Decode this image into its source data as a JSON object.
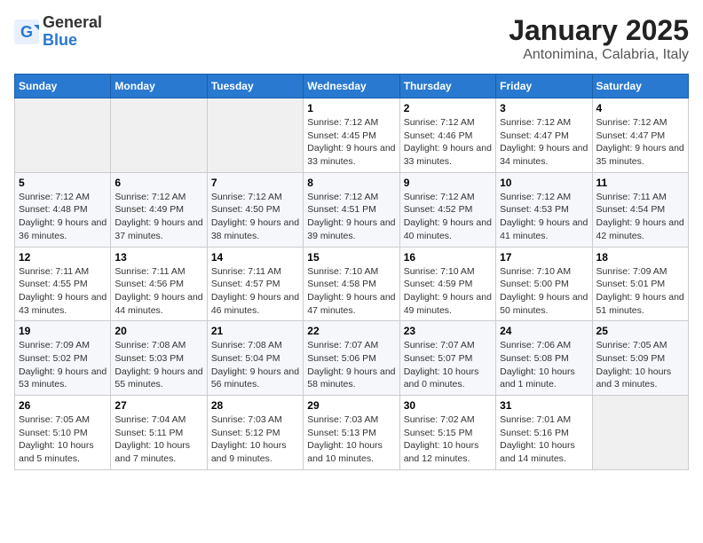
{
  "header": {
    "logo_general": "General",
    "logo_blue": "Blue",
    "month": "January 2025",
    "location": "Antonimina, Calabria, Italy"
  },
  "weekdays": [
    "Sunday",
    "Monday",
    "Tuesday",
    "Wednesday",
    "Thursday",
    "Friday",
    "Saturday"
  ],
  "weeks": [
    [
      {
        "day": "",
        "info": ""
      },
      {
        "day": "",
        "info": ""
      },
      {
        "day": "",
        "info": ""
      },
      {
        "day": "1",
        "info": "Sunrise: 7:12 AM\nSunset: 4:45 PM\nDaylight: 9 hours and 33 minutes."
      },
      {
        "day": "2",
        "info": "Sunrise: 7:12 AM\nSunset: 4:46 PM\nDaylight: 9 hours and 33 minutes."
      },
      {
        "day": "3",
        "info": "Sunrise: 7:12 AM\nSunset: 4:47 PM\nDaylight: 9 hours and 34 minutes."
      },
      {
        "day": "4",
        "info": "Sunrise: 7:12 AM\nSunset: 4:47 PM\nDaylight: 9 hours and 35 minutes."
      }
    ],
    [
      {
        "day": "5",
        "info": "Sunrise: 7:12 AM\nSunset: 4:48 PM\nDaylight: 9 hours and 36 minutes."
      },
      {
        "day": "6",
        "info": "Sunrise: 7:12 AM\nSunset: 4:49 PM\nDaylight: 9 hours and 37 minutes."
      },
      {
        "day": "7",
        "info": "Sunrise: 7:12 AM\nSunset: 4:50 PM\nDaylight: 9 hours and 38 minutes."
      },
      {
        "day": "8",
        "info": "Sunrise: 7:12 AM\nSunset: 4:51 PM\nDaylight: 9 hours and 39 minutes."
      },
      {
        "day": "9",
        "info": "Sunrise: 7:12 AM\nSunset: 4:52 PM\nDaylight: 9 hours and 40 minutes."
      },
      {
        "day": "10",
        "info": "Sunrise: 7:12 AM\nSunset: 4:53 PM\nDaylight: 9 hours and 41 minutes."
      },
      {
        "day": "11",
        "info": "Sunrise: 7:11 AM\nSunset: 4:54 PM\nDaylight: 9 hours and 42 minutes."
      }
    ],
    [
      {
        "day": "12",
        "info": "Sunrise: 7:11 AM\nSunset: 4:55 PM\nDaylight: 9 hours and 43 minutes."
      },
      {
        "day": "13",
        "info": "Sunrise: 7:11 AM\nSunset: 4:56 PM\nDaylight: 9 hours and 44 minutes."
      },
      {
        "day": "14",
        "info": "Sunrise: 7:11 AM\nSunset: 4:57 PM\nDaylight: 9 hours and 46 minutes."
      },
      {
        "day": "15",
        "info": "Sunrise: 7:10 AM\nSunset: 4:58 PM\nDaylight: 9 hours and 47 minutes."
      },
      {
        "day": "16",
        "info": "Sunrise: 7:10 AM\nSunset: 4:59 PM\nDaylight: 9 hours and 49 minutes."
      },
      {
        "day": "17",
        "info": "Sunrise: 7:10 AM\nSunset: 5:00 PM\nDaylight: 9 hours and 50 minutes."
      },
      {
        "day": "18",
        "info": "Sunrise: 7:09 AM\nSunset: 5:01 PM\nDaylight: 9 hours and 51 minutes."
      }
    ],
    [
      {
        "day": "19",
        "info": "Sunrise: 7:09 AM\nSunset: 5:02 PM\nDaylight: 9 hours and 53 minutes."
      },
      {
        "day": "20",
        "info": "Sunrise: 7:08 AM\nSunset: 5:03 PM\nDaylight: 9 hours and 55 minutes."
      },
      {
        "day": "21",
        "info": "Sunrise: 7:08 AM\nSunset: 5:04 PM\nDaylight: 9 hours and 56 minutes."
      },
      {
        "day": "22",
        "info": "Sunrise: 7:07 AM\nSunset: 5:06 PM\nDaylight: 9 hours and 58 minutes."
      },
      {
        "day": "23",
        "info": "Sunrise: 7:07 AM\nSunset: 5:07 PM\nDaylight: 10 hours and 0 minutes."
      },
      {
        "day": "24",
        "info": "Sunrise: 7:06 AM\nSunset: 5:08 PM\nDaylight: 10 hours and 1 minute."
      },
      {
        "day": "25",
        "info": "Sunrise: 7:05 AM\nSunset: 5:09 PM\nDaylight: 10 hours and 3 minutes."
      }
    ],
    [
      {
        "day": "26",
        "info": "Sunrise: 7:05 AM\nSunset: 5:10 PM\nDaylight: 10 hours and 5 minutes."
      },
      {
        "day": "27",
        "info": "Sunrise: 7:04 AM\nSunset: 5:11 PM\nDaylight: 10 hours and 7 minutes."
      },
      {
        "day": "28",
        "info": "Sunrise: 7:03 AM\nSunset: 5:12 PM\nDaylight: 10 hours and 9 minutes."
      },
      {
        "day": "29",
        "info": "Sunrise: 7:03 AM\nSunset: 5:13 PM\nDaylight: 10 hours and 10 minutes."
      },
      {
        "day": "30",
        "info": "Sunrise: 7:02 AM\nSunset: 5:15 PM\nDaylight: 10 hours and 12 minutes."
      },
      {
        "day": "31",
        "info": "Sunrise: 7:01 AM\nSunset: 5:16 PM\nDaylight: 10 hours and 14 minutes."
      },
      {
        "day": "",
        "info": ""
      }
    ]
  ]
}
